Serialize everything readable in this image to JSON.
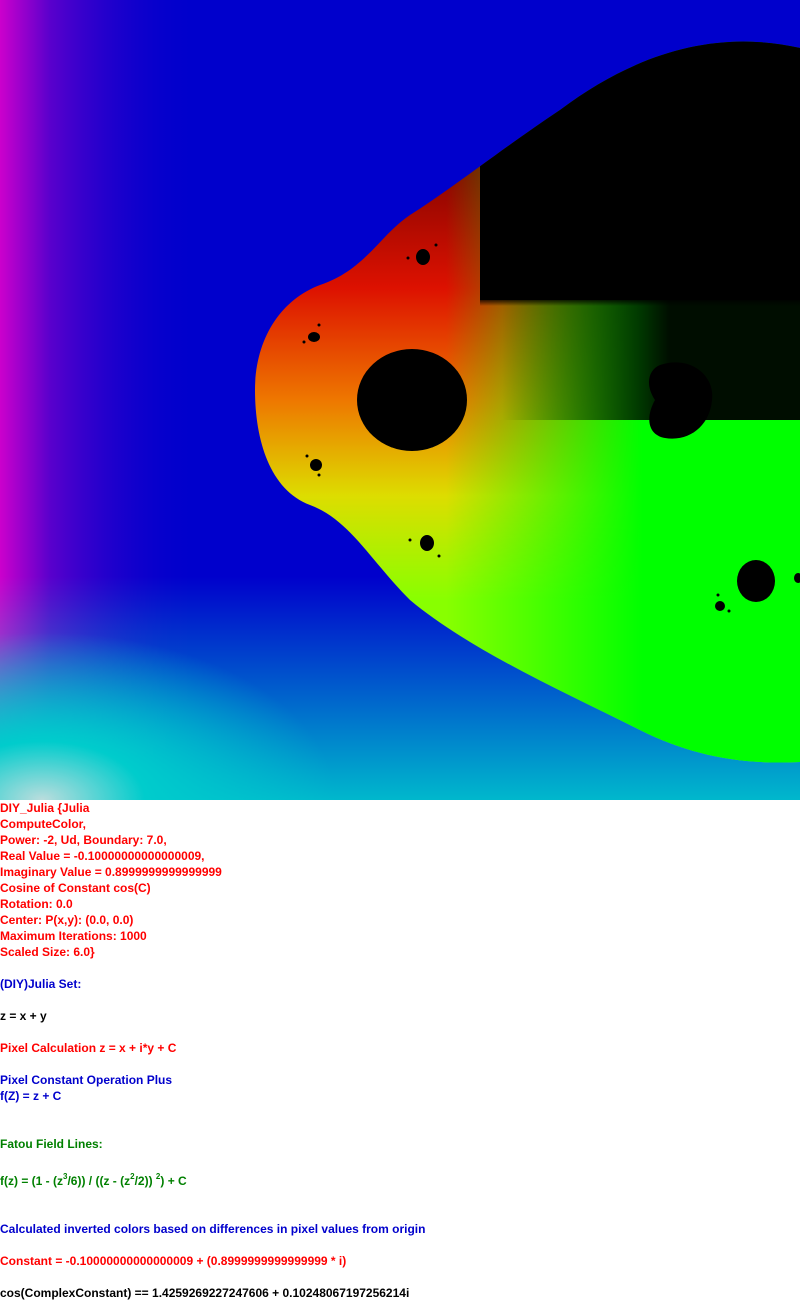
{
  "fractal": {
    "colors": {
      "background_blue": "#0000cc",
      "left_magenta": "#cc00cc",
      "bottom_cyan": "#00cccc",
      "set_red": "#dd1100",
      "set_orange": "#ee7700",
      "set_yellow": "#dddd00",
      "set_green": "#00ff00",
      "interior_black": "#000000"
    }
  },
  "info": {
    "l1": "DIY_Julia {Julia",
    "l2": "ComputeColor,",
    "l3": "Power: -2, Ud, Boundary: 7.0,",
    "l4": "Real Value = -0.10000000000000009,",
    "l5": "Imaginary Value = 0.8999999999999999",
    "l6": "Cosine of Constant cos(C)",
    "l7": "Rotation: 0.0",
    "l8": "Center: P(x,y): (0.0, 0.0)",
    "l9": "Maximum Iterations: 1000",
    "l10": "Scaled Size: 6.0}",
    "l11": "(DIY)Julia Set:",
    "l12": "z = x + y",
    "l13": "Pixel Calculation z = x + i*y + C",
    "l14": "Pixel Constant Operation Plus",
    "l15": "f(Z) = z + C",
    "l16": "Fatou Field Lines:",
    "formula": {
      "p1": "f(z) = (1 - (z",
      "s1": "3",
      "p2": "/6)) / ((z - (z",
      "s2": "2",
      "p3": "/2)) ",
      "s3": "2",
      "p4": ") + C"
    },
    "l18": "Calculated inverted colors based on differences in pixel values from origin",
    "l19": "Constant = -0.10000000000000009 + (0.8999999999999999 * i)",
    "l20": "cos(ComplexConstant) == 1.4259269227247606 + 0.10248067197256214i"
  }
}
